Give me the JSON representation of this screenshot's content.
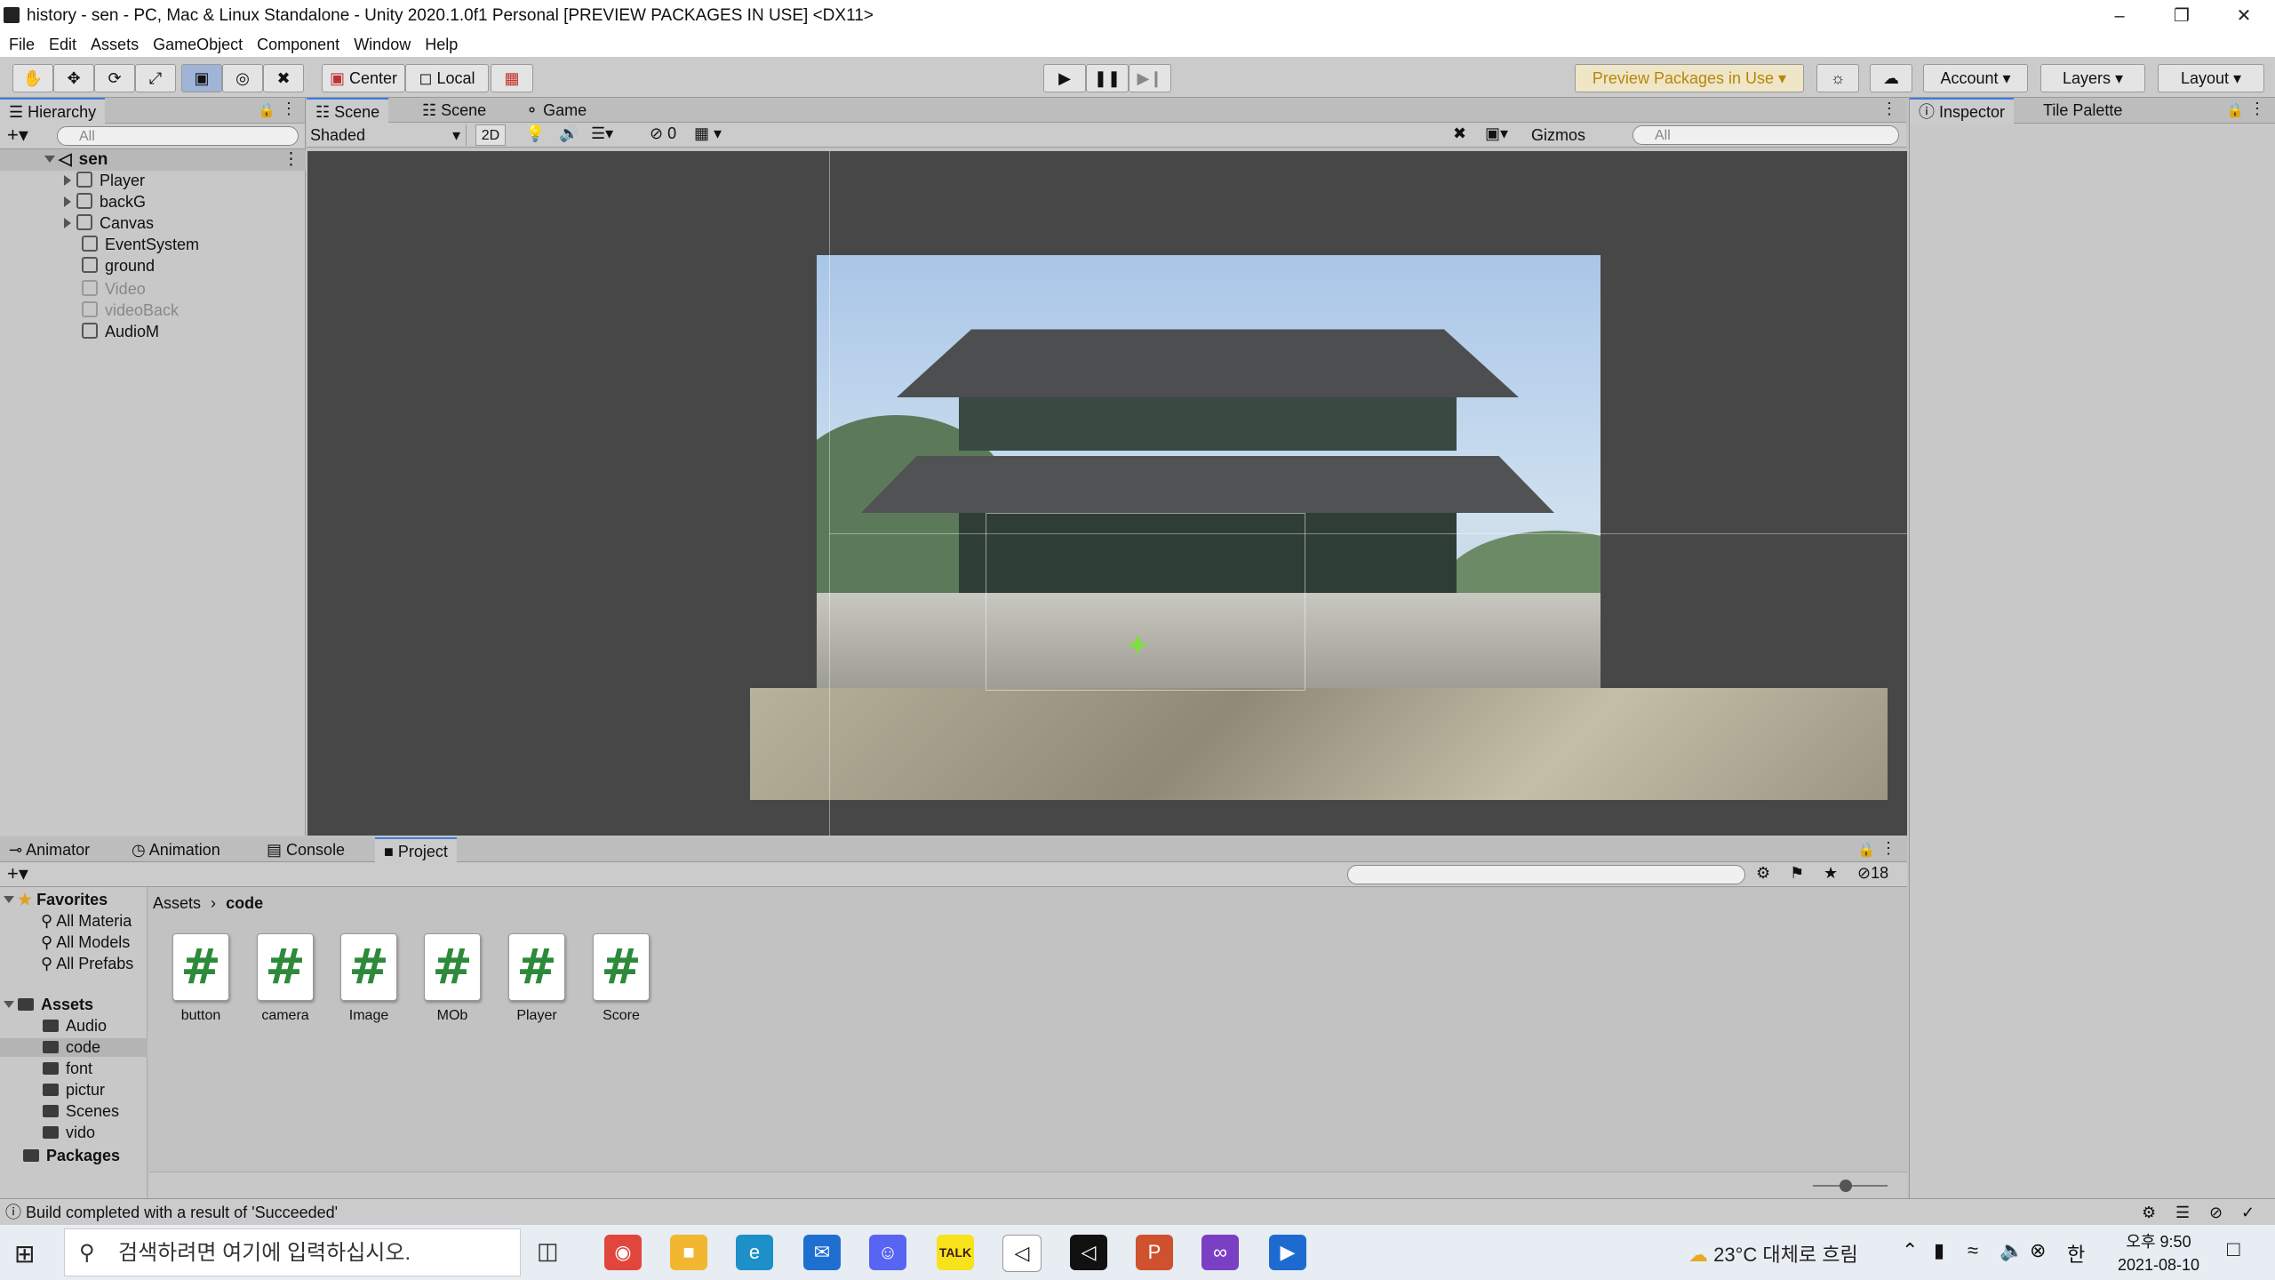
{
  "window": {
    "title": "history - sen - PC, Mac & Linux Standalone - Unity 2020.1.0f1 Personal [PREVIEW PACKAGES IN USE] <DX11>"
  },
  "menu": [
    "File",
    "Edit",
    "Assets",
    "GameObject",
    "Component",
    "Window",
    "Help"
  ],
  "toolbar": {
    "pivot": "Center",
    "space": "Local",
    "preview_packages": "Preview Packages in Use",
    "account": "Account",
    "layers": "Layers",
    "layout": "Layout"
  },
  "hierarchy": {
    "tab": "Hierarchy",
    "search_placeholder": "All",
    "scene_name": "sen",
    "items": [
      {
        "label": "Player",
        "expandable": true,
        "active": true
      },
      {
        "label": "backG",
        "expandable": true,
        "active": true
      },
      {
        "label": "Canvas",
        "expandable": true,
        "active": true
      },
      {
        "label": "EventSystem",
        "expandable": false,
        "active": true
      },
      {
        "label": "ground",
        "expandable": false,
        "active": true
      },
      {
        "label": "Video",
        "expandable": false,
        "active": false
      },
      {
        "label": "videoBack",
        "expandable": false,
        "active": false
      },
      {
        "label": "AudioM",
        "expandable": false,
        "active": true
      }
    ]
  },
  "scene_tabs": [
    "Scene",
    "Scene",
    "Game"
  ],
  "scene_toolbar": {
    "draw_mode": "Shaded",
    "mode_2d": "2D",
    "hidden_count": "0",
    "gizmos": "Gizmos",
    "search_placeholder": "All"
  },
  "inspector": {
    "tabs": [
      "Inspector",
      "Tile Palette"
    ]
  },
  "bottom_tabs": [
    "Animator",
    "Animation",
    "Console",
    "Project"
  ],
  "project": {
    "hidden_count": "18",
    "breadcrumb": [
      "Assets",
      "code"
    ],
    "favorites_label": "Favorites",
    "favorites": [
      "All Materia",
      "All Models",
      "All Prefabs"
    ],
    "assets_label": "Assets",
    "folders": [
      "Audio",
      "code",
      "font",
      "pictur",
      "Scenes",
      "vido"
    ],
    "packages_label": "Packages",
    "scripts": [
      "button",
      "camera",
      "Image",
      "MOb",
      "Player",
      "Score"
    ]
  },
  "status": {
    "message": "Build completed with a result of 'Succeeded'"
  },
  "taskbar": {
    "search_placeholder": "검색하려면 여기에 입력하십시오.",
    "weather": "23°C 대체로 흐림",
    "ime": "한",
    "time": "오후 9:50",
    "date": "2021-08-10"
  }
}
